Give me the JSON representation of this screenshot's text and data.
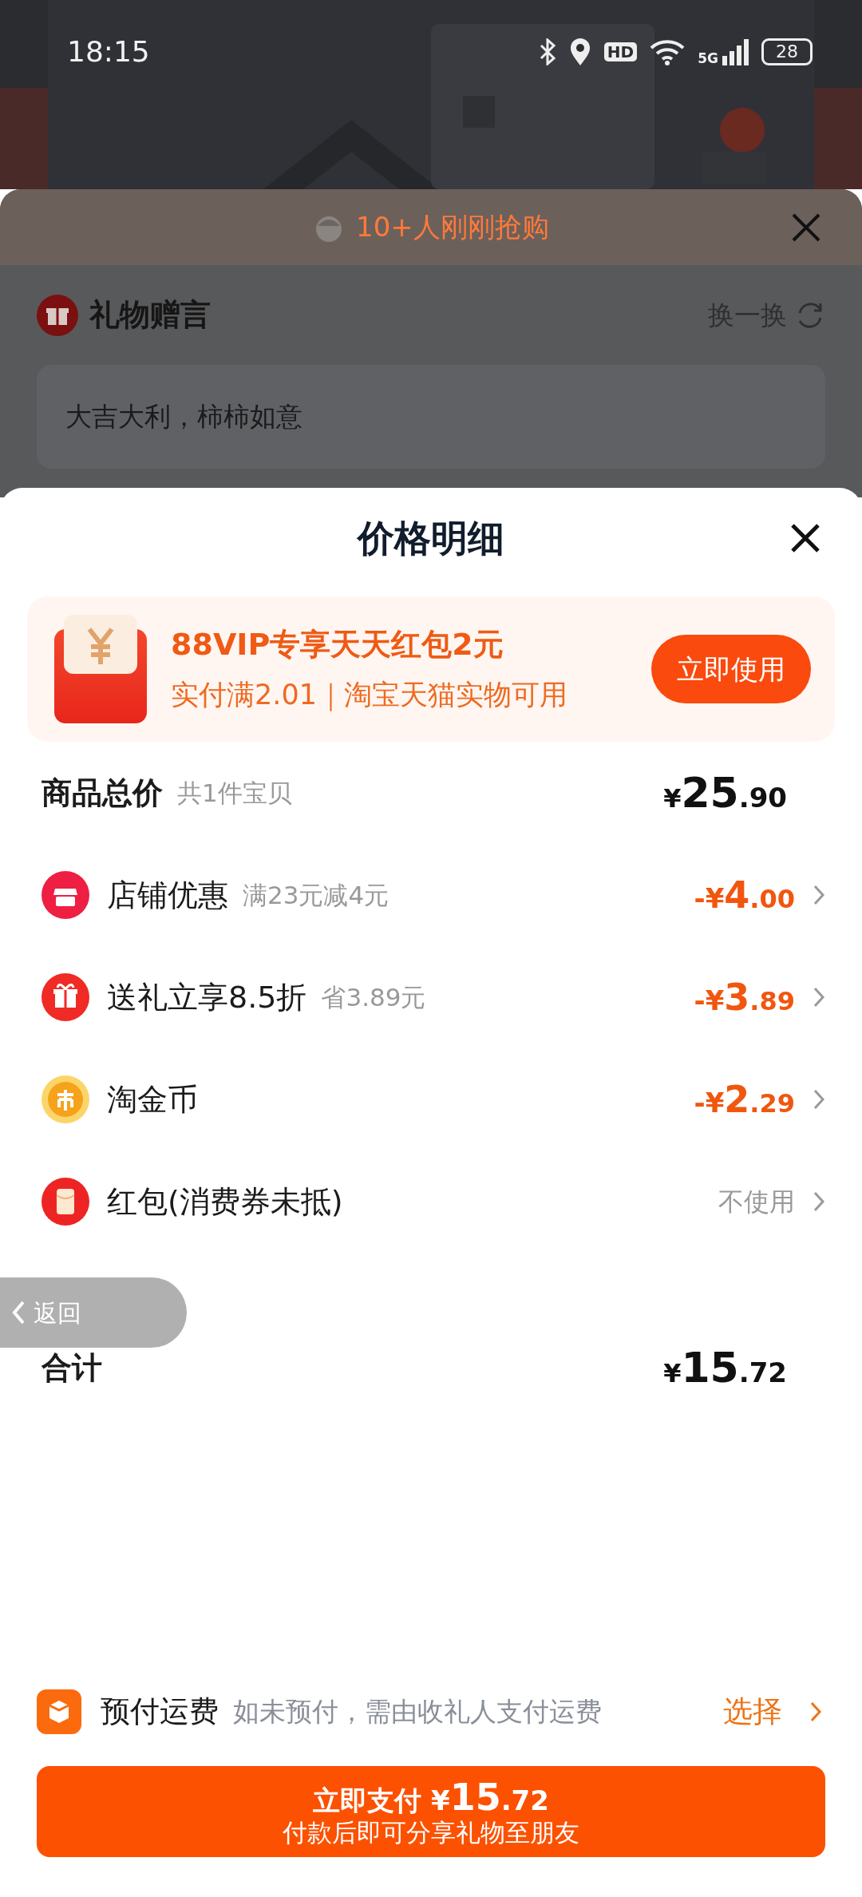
{
  "status_bar": {
    "time": "18:15",
    "hd_badge": "HD",
    "network": "5G",
    "battery": "28"
  },
  "background_sheet": {
    "notice": "10+人刚刚抢购",
    "gift_message": {
      "title": "礼物赠言",
      "refresh": "换一换",
      "message": "大吉大利，柿柿如意"
    }
  },
  "price_sheet": {
    "title": "价格明细",
    "coupon": {
      "title": "88VIP专享天天红包2元",
      "subtitle": "实付满2.01｜淘宝天猫实物可用",
      "button": "立即使用"
    },
    "subtotal": {
      "label": "商品总价",
      "note": "共1件宝贝",
      "currency": "¥",
      "integer": "25",
      "decimal": ".90"
    },
    "discounts": [
      {
        "kind": "shop",
        "label": "店铺优惠",
        "note": "满23元减4元",
        "amount": {
          "sign": "-¥",
          "integer": "4",
          "decimal": ".00"
        }
      },
      {
        "kind": "gift",
        "label": "送礼立享8.5折",
        "note": "省3.89元",
        "amount": {
          "sign": "-¥",
          "integer": "3",
          "decimal": ".89"
        }
      },
      {
        "kind": "coin",
        "label": "淘金币",
        "amount": {
          "sign": "-¥",
          "integer": "2",
          "decimal": ".29"
        }
      },
      {
        "kind": "redpacket",
        "label": "红包(消费券未抵)",
        "status": "不使用"
      }
    ],
    "total": {
      "label": "合计",
      "currency": "¥",
      "integer": "15",
      "decimal": ".72"
    },
    "shipping": {
      "label": "预付运费",
      "note": "如未预付，需由收礼人支付运费",
      "action": "选择"
    },
    "pay_button": {
      "label": "立即支付",
      "currency": "¥",
      "integer": "15",
      "decimal": ".72",
      "subtitle": "付款后即可分享礼物至朋友"
    }
  },
  "back_pill": {
    "label": "返回"
  }
}
